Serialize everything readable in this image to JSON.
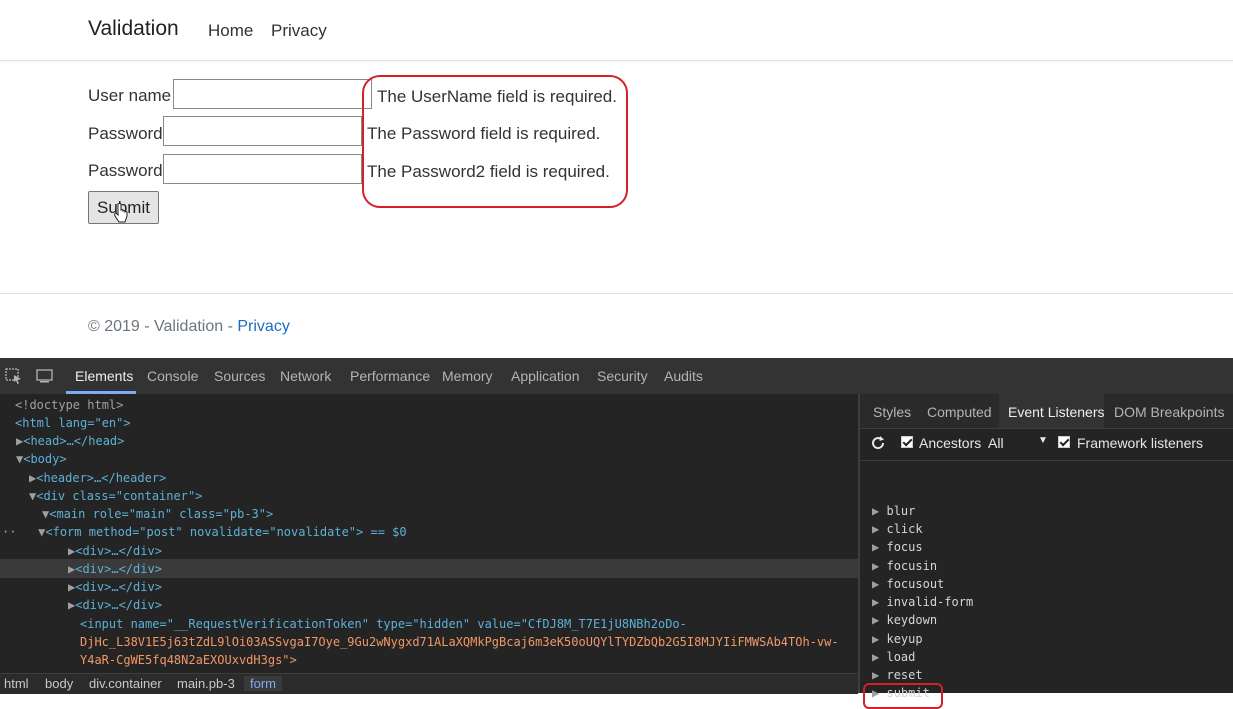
{
  "page": {
    "brand": "Validation",
    "nav": [
      "Home",
      "Privacy"
    ],
    "form": {
      "username_label": "User name",
      "password_label": "Password",
      "password2_label": "Password",
      "username_value": "",
      "password_value": "",
      "password2_value": "",
      "errors": [
        "The UserName field is required.",
        "The Password field is required.",
        "The Password2 field is required."
      ],
      "submit_label": "Submit"
    },
    "footer": {
      "text": "© 2019 - Validation - ",
      "link": "Privacy"
    }
  },
  "devtools": {
    "tabs": [
      "Elements",
      "Console",
      "Sources",
      "Network",
      "Performance",
      "Memory",
      "Application",
      "Security",
      "Audits"
    ],
    "active_tab": "Elements",
    "dom_lines": [
      "<!doctype html>",
      "<html lang=\"en\">",
      "<head>…</head>",
      "<body>",
      "<header>…</header>",
      "<div class=\"container\">",
      "<main role=\"main\" class=\"pb-3\">",
      "<form method=\"post\" novalidate=\"novalidate\"> == $0",
      "<div>…</div>",
      "<div>…</div>",
      "<div>…</div>",
      "<div>…</div>",
      "<input name=\"__RequestVerificationToken\" type=\"hidden\" value=\"CfDJ8M_T7E1jU8NBh2oDo-",
      "DjHc_L38V1E5j63tZdL9lOi03ASSvgaI7Oye_9Gu2wNygxd71ALaXQMkPgBcaj6m3eK50oUQYlTYDZbQb2G5I8MJYIiFMWSAb4TOh-vw-",
      "Y4aR-CgWE5fq48N2aEXOUxvdH3gs\">"
    ],
    "breadcrumbs": [
      "html",
      "body",
      "div.container",
      "main.pb-3",
      "form"
    ],
    "side_tabs": [
      "Styles",
      "Computed",
      "Event Listeners",
      "DOM Breakpoints"
    ],
    "active_side_tab": "Event Listeners",
    "toolbar": {
      "ancestors_label": "Ancestors",
      "filter_value": "All",
      "framework_label": "Framework listeners"
    },
    "events": [
      "blur",
      "click",
      "focus",
      "focusin",
      "focusout",
      "invalid-form",
      "keydown",
      "keyup",
      "load",
      "reset",
      "submit"
    ],
    "colors": {
      "highlight": "#d4202a",
      "accent": "#7cacf8",
      "link": "#1b6ec2"
    }
  }
}
